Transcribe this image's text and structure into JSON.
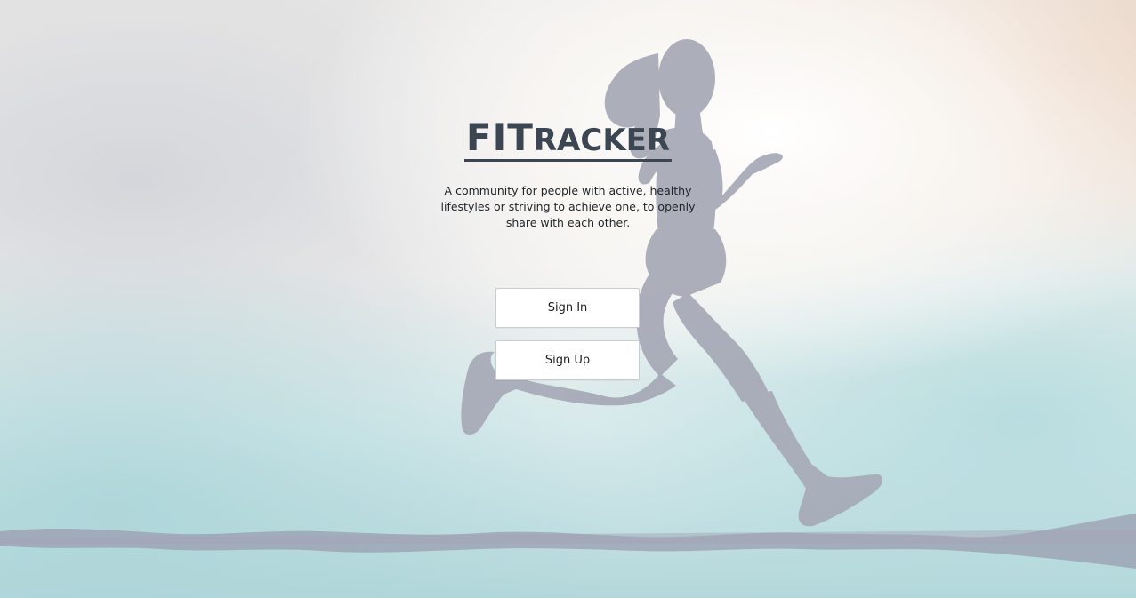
{
  "brand": {
    "first": "FIT",
    "rest": "racker"
  },
  "tagline": "A community for people with active, healthy lifestyles or striving to achieve one, to openly share with each other.",
  "buttons": {
    "sign_in": "Sign In",
    "sign_up": "Sign Up"
  },
  "background": {
    "image": "runner-silhouette",
    "colors": {
      "sky_light": "#f4f1ee",
      "sky_warm": "#e9c9b0",
      "sky_teal": "#a9d6d8",
      "sky_gray": "#b9bfc8",
      "silhouette": "#9b9fad"
    }
  }
}
